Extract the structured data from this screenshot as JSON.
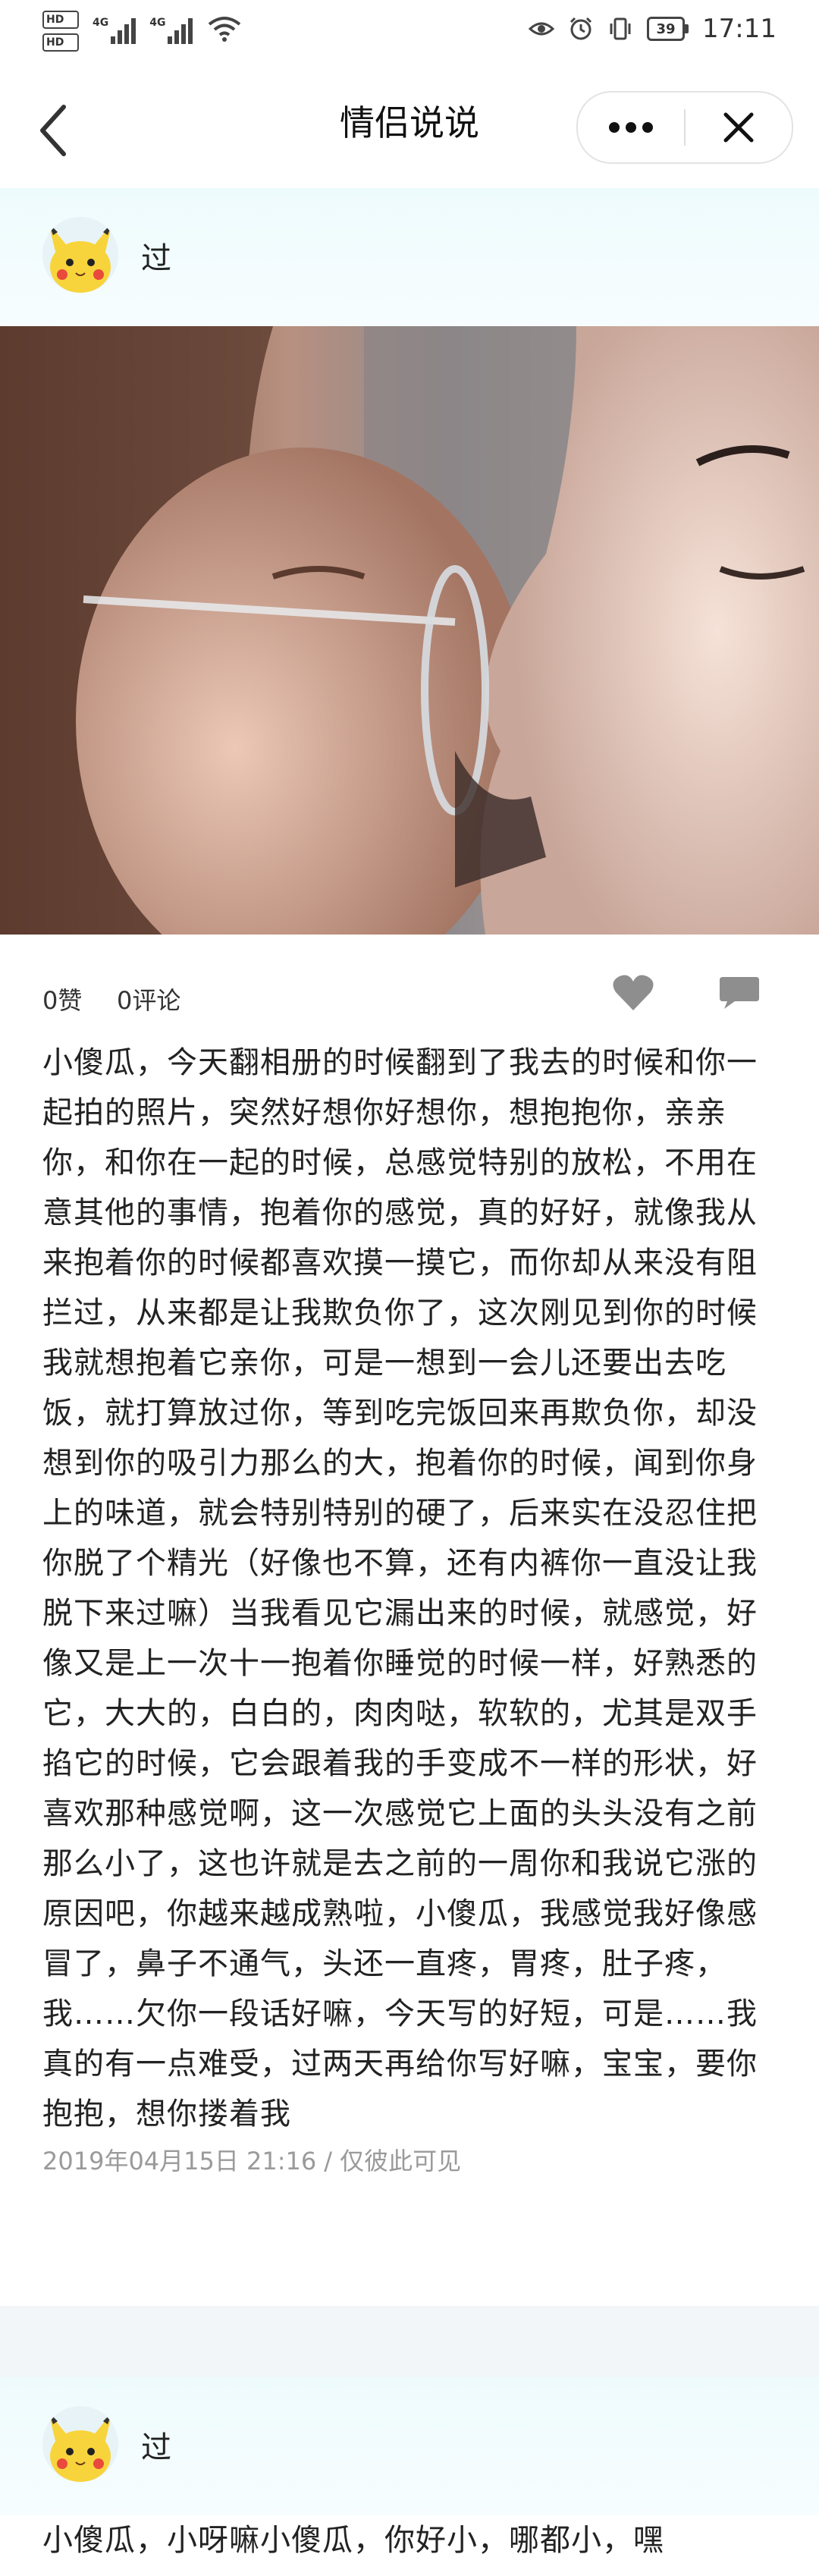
{
  "status_bar": {
    "hd1": "HD",
    "hd2": "HD",
    "net1": "4G",
    "net2": "4G",
    "battery": "39",
    "time": "17:11",
    "icons": [
      "eye-icon",
      "alarm-icon",
      "vibrate-icon",
      "battery-icon"
    ]
  },
  "nav": {
    "title": "情侣说说",
    "back_icon": "chevron-left-icon",
    "more_icon": "more-dots-icon",
    "close_icon": "close-icon"
  },
  "posts": [
    {
      "author": "过",
      "avatar_icon": "pikachu-avatar",
      "likes": "0赞",
      "comments": "0评论",
      "text": "小傻瓜，今天翻相册的时候翻到了我去的时候和你一起拍的照片，突然好想你好想你，想抱抱你，亲亲你，和你在一起的时候，总感觉特别的放松，不用在意其他的事情，抱着你的感觉，真的好好，就像我从来抱着你的时候都喜欢摸一摸它，而你却从来没有阻拦过，从来都是让我欺负你了，这次刚见到你的时候我就想抱着它亲你，可是一想到一会儿还要出去吃饭，就打算放过你，等到吃完饭回来再欺负你，却没想到你的吸引力那么的大，抱着你的时候，闻到你身上的味道，就会特别特别的硬了，后来实在没忍住把你脱了个精光（好像也不算，还有内裤你一直没让我脱下来过嘛）当我看见它漏出来的时候，就感觉，好像又是上一次十一抱着你睡觉的时候一样，好熟悉的它，大大的，白白的，肉肉哒，软软的，尤其是双手掐它的时候，它会跟着我的手变成不一样的形状，好喜欢那种感觉啊，这一次感觉它上面的头头没有之前那么小了，这也许就是去之前的一周你和我说它涨的原因吧，你越来越成熟啦，小傻瓜，我感觉我好像感冒了，鼻子不通气，头还一直疼，胃疼，肚子疼，我……欠你一段话好嘛，今天写的好短，可是……我真的有一点难受，过两天再给你写好嘛，宝宝，要你抱抱，想你搂着我",
      "date": "2019年04月15日 21:16",
      "separator": "/",
      "visibility": "仅彼此可见"
    },
    {
      "author": "过",
      "avatar_icon": "pikachu-avatar",
      "text": "小傻瓜，小呀嘛小傻瓜，你好小，哪都小，嘿"
    }
  ]
}
